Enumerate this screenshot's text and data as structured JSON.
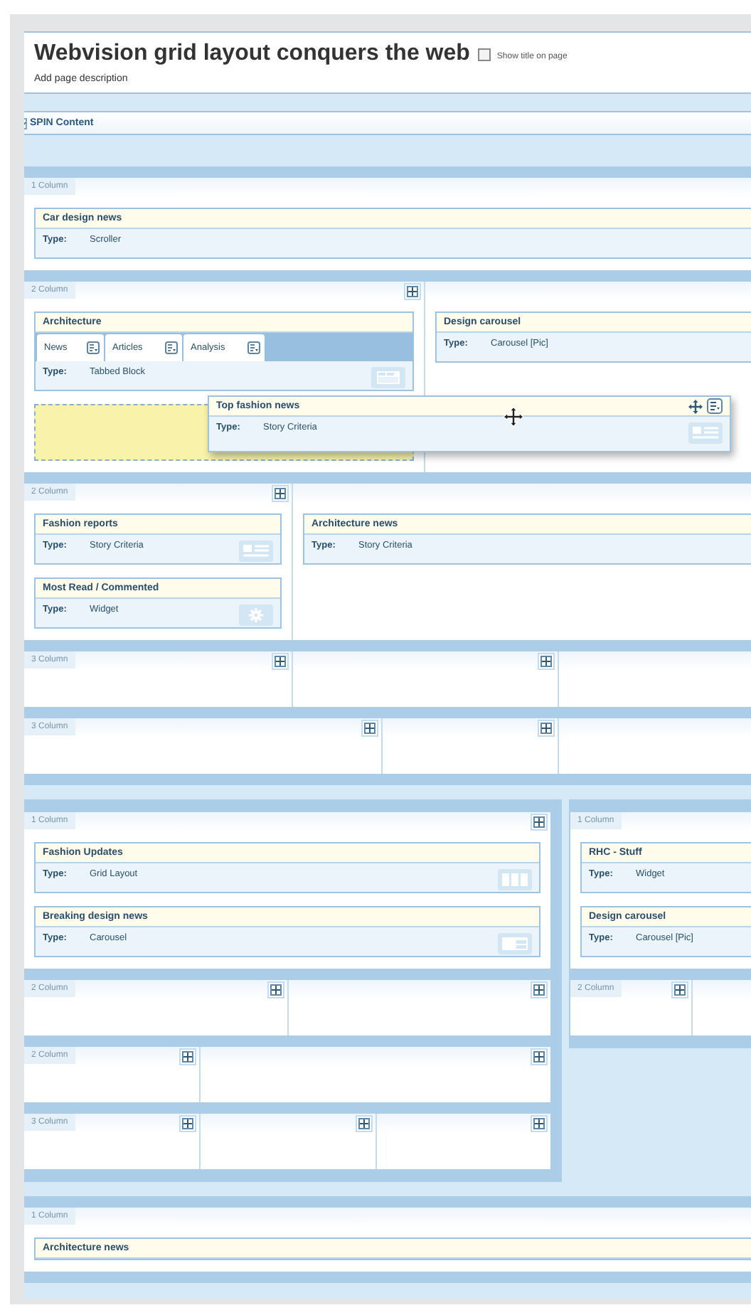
{
  "page": {
    "title": "Webvision grid layout conquers the web",
    "show_title": {
      "label": "Show title on page",
      "checked": false
    },
    "description": "Add page description"
  },
  "spin_section": {
    "title": "SPIN Content"
  },
  "rows": [
    {
      "kind": "row",
      "label": "1 Column",
      "columns": [
        {
          "add_button": false,
          "blocks": [
            {
              "kind": "scroller",
              "title": "Car design news",
              "type_label": "Type:",
              "type_value": "Scroller"
            }
          ]
        }
      ]
    },
    {
      "kind": "row",
      "label": "2 Column",
      "dragging": {
        "kind": "story",
        "title": "Top fashion news",
        "type_label": "Type:",
        "type_value": "Story Criteria"
      },
      "columns": [
        {
          "add_button": true,
          "blocks": [
            {
              "kind": "tabbed",
              "title": "Architecture",
              "tabs": [
                {
                  "label": "News"
                },
                {
                  "label": "Articles"
                },
                {
                  "label": "Analysis"
                }
              ],
              "type_label": "Type:",
              "type_value": "Tabbed Block"
            },
            {
              "kind": "placeholder"
            }
          ]
        },
        {
          "add_button": false,
          "blocks": [
            {
              "kind": "carousel_pic",
              "title": "Design carousel",
              "type_label": "Type:",
              "type_value": "Carousel [Pic]"
            }
          ]
        }
      ]
    },
    {
      "kind": "row",
      "label": "2 Column",
      "columns": [
        {
          "add_button": true,
          "blocks": [
            {
              "kind": "story",
              "title": "Fashion reports",
              "type_label": "Type:",
              "type_value": "Story Criteria"
            },
            {
              "kind": "widget",
              "title": "Most Read / Commented",
              "type_label": "Type:",
              "type_value": "Widget"
            }
          ]
        },
        {
          "add_button": false,
          "blocks": [
            {
              "kind": "story_wide",
              "title": "Architecture news",
              "type_label": "Type:",
              "type_value": "Story Criteria"
            }
          ]
        }
      ]
    },
    {
      "kind": "row",
      "label": "3 Column",
      "columns": [
        {
          "add_button": true
        },
        {
          "add_button": true
        },
        {
          "add_button": false
        }
      ]
    },
    {
      "kind": "row",
      "label": "3 Column",
      "columns": [
        {
          "add_button": true
        },
        {
          "add_button": true
        },
        {
          "add_button": false
        }
      ]
    },
    {
      "kind": "split",
      "panels": [
        {
          "rows": [
            {
              "label": "1 Column",
              "columns": [
                {
                  "add_button": true,
                  "blocks": [
                    {
                      "kind": "grid",
                      "title": "Fashion Updates",
                      "type_label": "Type:",
                      "type_value": "Grid Layout"
                    },
                    {
                      "kind": "carousel",
                      "title": "Breaking design news",
                      "type_label": "Type:",
                      "type_value": "Carousel"
                    }
                  ]
                }
              ]
            },
            {
              "label": "2 Column",
              "columns": [
                {
                  "add_button": true
                },
                {
                  "add_button": true
                }
              ]
            },
            {
              "label": "2 Column",
              "columns": [
                {
                  "add_button": true
                },
                {
                  "add_button": true
                }
              ]
            },
            {
              "label": "3 Column",
              "columns": [
                {
                  "add_button": true
                },
                {
                  "add_button": true
                },
                {
                  "add_button": true
                }
              ]
            }
          ]
        },
        {
          "rows": [
            {
              "label": "1 Column",
              "columns": [
                {
                  "add_button": false,
                  "blocks": [
                    {
                      "kind": "widget_wide",
                      "title": "RHC - Stuff",
                      "type_label": "Type:",
                      "type_value": "Widget"
                    },
                    {
                      "kind": "carousel_pic",
                      "title": "Design carousel",
                      "type_label": "Type:",
                      "type_value": "Carousel [Pic]"
                    }
                  ]
                }
              ]
            },
            {
              "label": "2 Column",
              "columns": [
                {
                  "add_button": true
                },
                {
                  "add_button": false
                }
              ]
            }
          ]
        }
      ]
    },
    {
      "kind": "row",
      "label": "1 Column",
      "columns": [
        {
          "add_button": false,
          "blocks": [
            {
              "kind": "story_wide",
              "title": "Architecture news"
            }
          ]
        }
      ]
    }
  ]
}
